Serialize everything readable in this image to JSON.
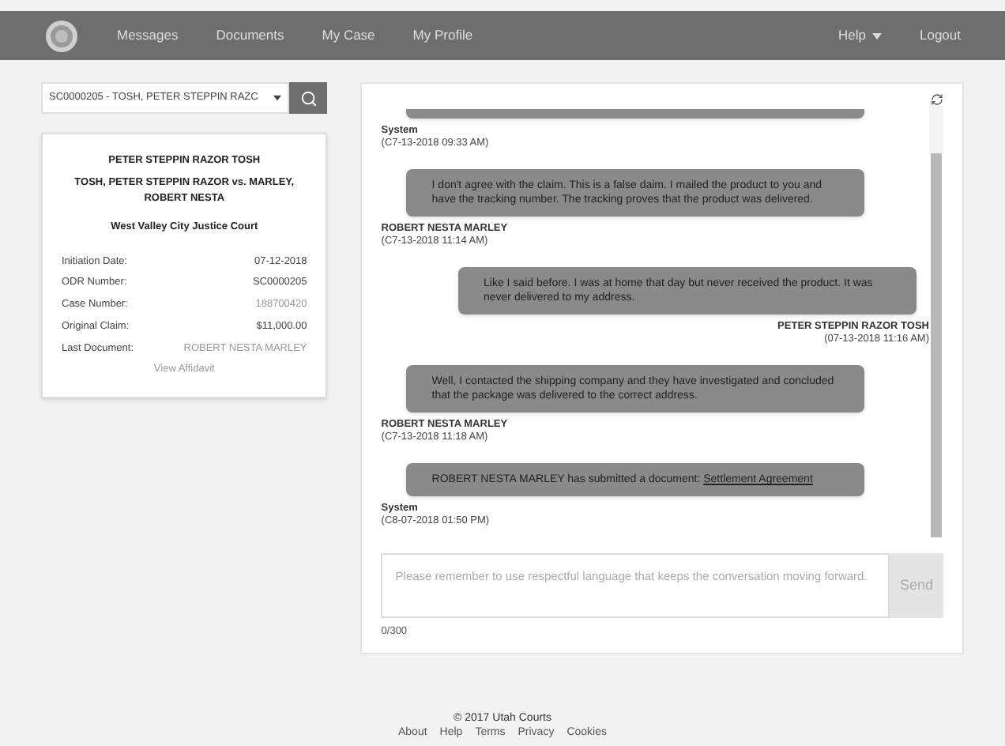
{
  "nav": {
    "items": [
      {
        "label": "Messages"
      },
      {
        "label": "Documents"
      },
      {
        "label": "My Case"
      },
      {
        "label": "My Profile"
      }
    ],
    "right": [
      {
        "label": "Help",
        "dropdown": true
      },
      {
        "label": "Logout",
        "dropdown": false
      }
    ]
  },
  "case_select": {
    "value": "SC0000205 - TOSH, PETER STEPPIN RAZC"
  },
  "case_card": {
    "party": "PETER STEPPIN RAZOR TOSH",
    "title": "TOSH, PETER STEPPIN RAZOR vs. MARLEY, ROBERT NESTA",
    "court": "West Valley City Justice Court",
    "fields": [
      {
        "label": "Initiation Date:",
        "value": "07-12-2018",
        "link": false
      },
      {
        "label": "ODR Number:",
        "value": "SC0000205",
        "link": false
      },
      {
        "label": "Case Number:",
        "value": "188700420",
        "link": true
      },
      {
        "label": "Original Claim:",
        "value": "$11,000.00",
        "link": false
      },
      {
        "label": "Last Document:",
        "value": "ROBERT NESTA MARLEY",
        "link": true
      }
    ],
    "action": "View Affidavit"
  },
  "chat": {
    "messages": [
      {
        "kind": "received",
        "author": "System",
        "time": "(C7-13-2018 09:33 AM)"
      },
      {
        "kind": "received",
        "text": "I don't agree with the claim. This is a false daim. I mailed the product to you and have the tracking number. The tracking proves that the product was delivered.",
        "author": "ROBERT NESTA MARLEY",
        "time": "(C7-13-2018 11:14 AM)"
      },
      {
        "kind": "sent",
        "text": "Like I said before. I was at home that day but never received the product. It was never delivered to my address.",
        "author": "PETER STEPPIN RAZOR TOSH",
        "time": "(07-13-2018 11:16 AM)"
      },
      {
        "kind": "received",
        "text": "Well, I contacted the shipping company and they have investigated and concluded that the package was delivered to the correct address.",
        "author": "ROBERT NESTA MARLEY",
        "time": "(C7-13-2018 11:18 AM)"
      },
      {
        "kind": "received",
        "text": "ROBERT NESTA MARLEY has submitted a document:",
        "link": "Settlement Agreement",
        "author": "System",
        "time": "(C8-07-2018 01:50 PM)"
      }
    ],
    "input": {
      "placeholder": "Please remember to use respectful language that keeps the conversation moving forward."
    },
    "send": "Send",
    "counter": "0/300"
  },
  "footer": {
    "copyright": "© 2017 Utah Courts",
    "links": [
      "About",
      "Help",
      "Terms",
      "Privacy",
      "Cookies"
    ]
  }
}
